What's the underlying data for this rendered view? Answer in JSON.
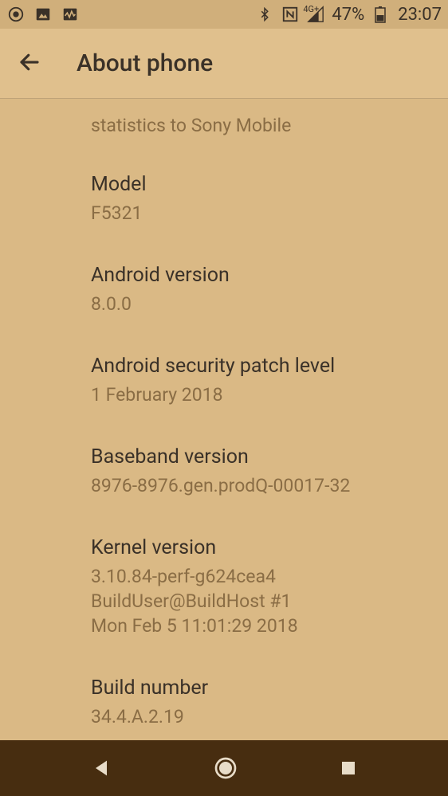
{
  "statusBar": {
    "batteryPercent": "47%",
    "clock": "23:07",
    "networkLabel": "4G+"
  },
  "appBar": {
    "title": "About phone"
  },
  "partialItem": {
    "subtitle": "statistics to Sony Mobile"
  },
  "items": [
    {
      "title": "Model",
      "value": "F5321"
    },
    {
      "title": "Android version",
      "value": "8.0.0"
    },
    {
      "title": "Android security patch level",
      "value": "1 February 2018"
    },
    {
      "title": "Baseband version",
      "value": "8976-8976.gen.prodQ-00017-32"
    },
    {
      "title": "Kernel version",
      "value": "3.10.84-perf-g624cea4\nBuildUser@BuildHost #1\nMon Feb 5 11:01:29 2018"
    },
    {
      "title": "Build number",
      "value": "34.4.A.2.19"
    }
  ]
}
